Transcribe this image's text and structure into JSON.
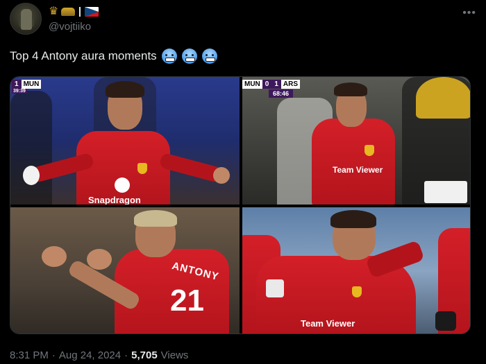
{
  "user": {
    "handle": "@vojtiiko"
  },
  "tweet": {
    "text": "Top 4 Antony aura moments",
    "emoji_icons": [
      "cold-face-icon",
      "cold-face-icon",
      "cold-face-icon"
    ]
  },
  "images": [
    {
      "scorebug": {
        "team": "MUN",
        "score": "1",
        "time": "39:39"
      },
      "sponsor": "Snapdragon"
    },
    {
      "scorebug": {
        "home": "MUN",
        "home_score": "0",
        "away_score": "1",
        "away": "ARS",
        "time": "68:46"
      },
      "sponsor": "Team Viewer"
    },
    {
      "shirt_name": "ANTONY",
      "shirt_number": "21"
    },
    {
      "sponsor": "Team Viewer"
    }
  ],
  "meta": {
    "time": "8:31 PM",
    "sep1": "·",
    "date": "Aug 24, 2024",
    "sep2": "·",
    "views_count": "5,705",
    "views_label": "Views"
  },
  "colors": {
    "background": "#000000",
    "text": "#e7e9ea",
    "muted": "#71767b",
    "united_red": "#d41f28"
  }
}
